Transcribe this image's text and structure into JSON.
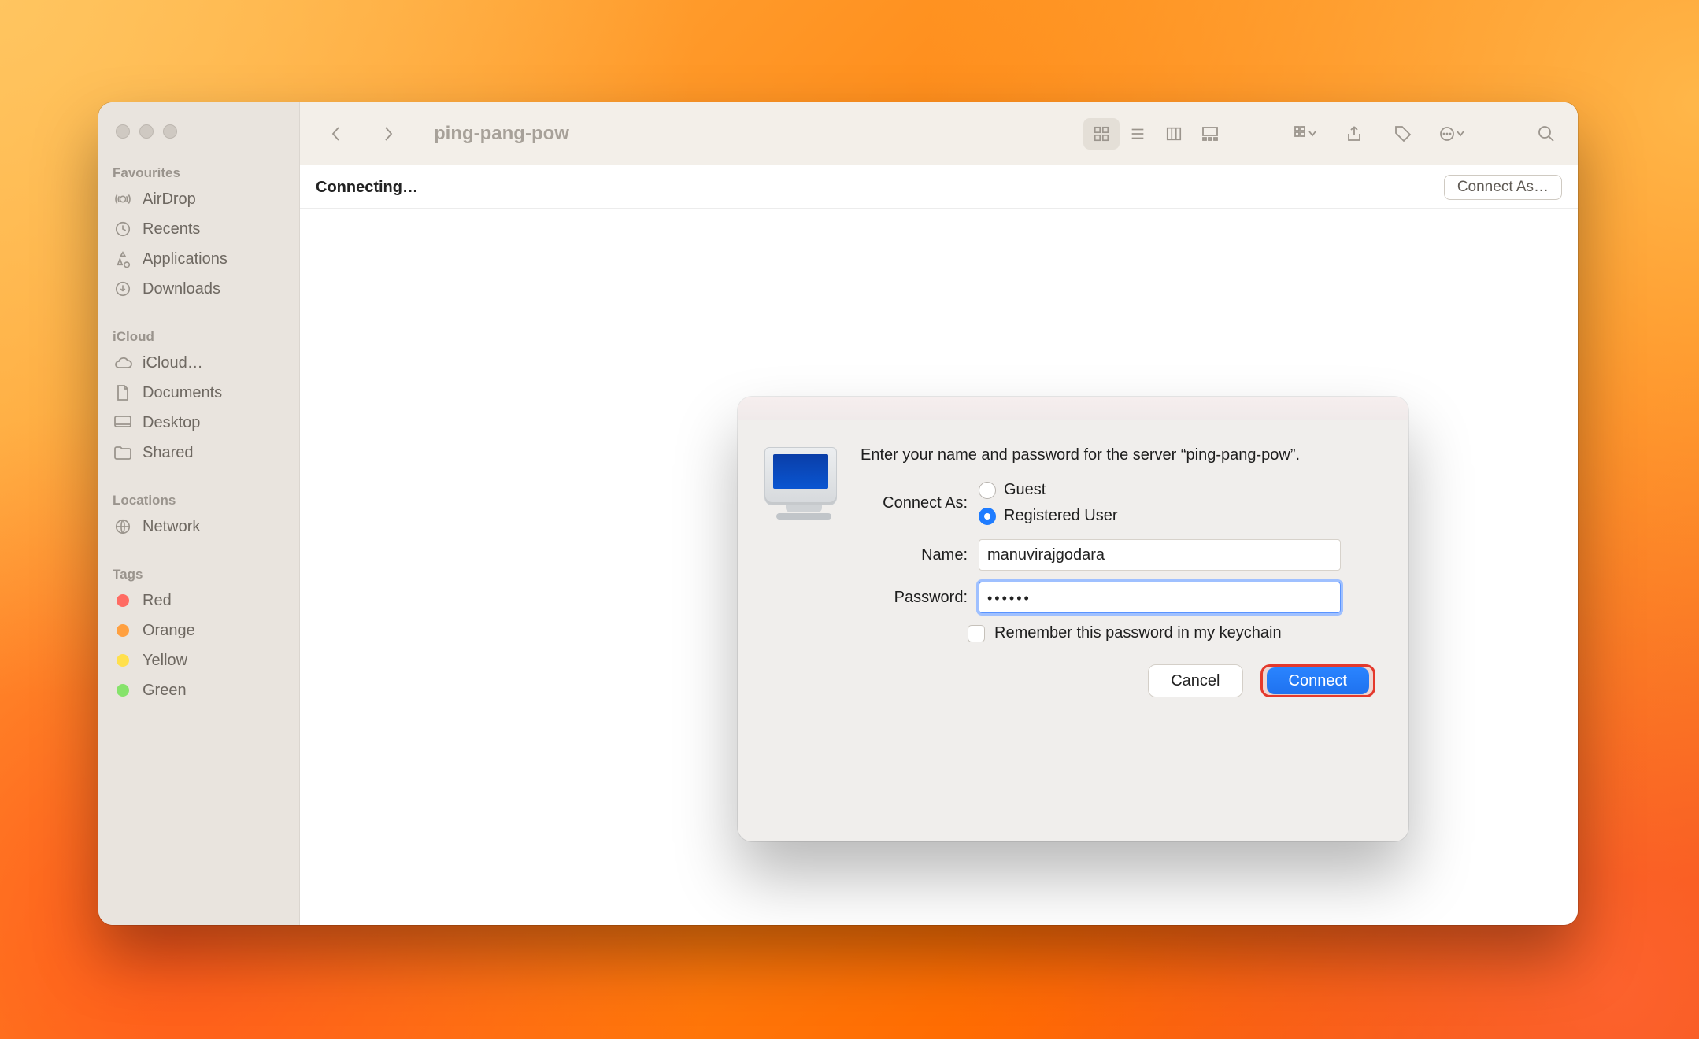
{
  "window": {
    "title": "ping-pang-pow",
    "status": "Connecting…",
    "connect_as_button": "Connect As…"
  },
  "sidebar": {
    "favourites_title": "Favourites",
    "favourites": [
      {
        "label": "AirDrop",
        "icon": "airdrop-icon"
      },
      {
        "label": "Recents",
        "icon": "clock-icon"
      },
      {
        "label": "Applications",
        "icon": "apps-icon"
      },
      {
        "label": "Downloads",
        "icon": "download-icon"
      }
    ],
    "icloud_title": "iCloud",
    "icloud": [
      {
        "label": "iCloud…",
        "icon": "cloud-icon"
      },
      {
        "label": "Documents",
        "icon": "doc-icon"
      },
      {
        "label": "Desktop",
        "icon": "desktop-icon"
      },
      {
        "label": "Shared",
        "icon": "folder-icon"
      }
    ],
    "locations_title": "Locations",
    "locations": [
      {
        "label": "Network",
        "icon": "globe-icon"
      }
    ],
    "tags_title": "Tags",
    "tags": [
      {
        "label": "Red",
        "color": "tag-red"
      },
      {
        "label": "Orange",
        "color": "tag-orange"
      },
      {
        "label": "Yellow",
        "color": "tag-yellow"
      },
      {
        "label": "Green",
        "color": "tag-green"
      }
    ]
  },
  "dialog": {
    "prompt": "Enter your name and password for the server “ping-pang-pow”.",
    "connect_as_label": "Connect As:",
    "guest_label": "Guest",
    "registered_label": "Registered User",
    "selected": "registered",
    "name_label": "Name:",
    "name_value": "manuvirajgodara",
    "password_label": "Password:",
    "password_mask": "••••••",
    "remember_label": "Remember this password in my keychain",
    "cancel": "Cancel",
    "connect": "Connect"
  }
}
